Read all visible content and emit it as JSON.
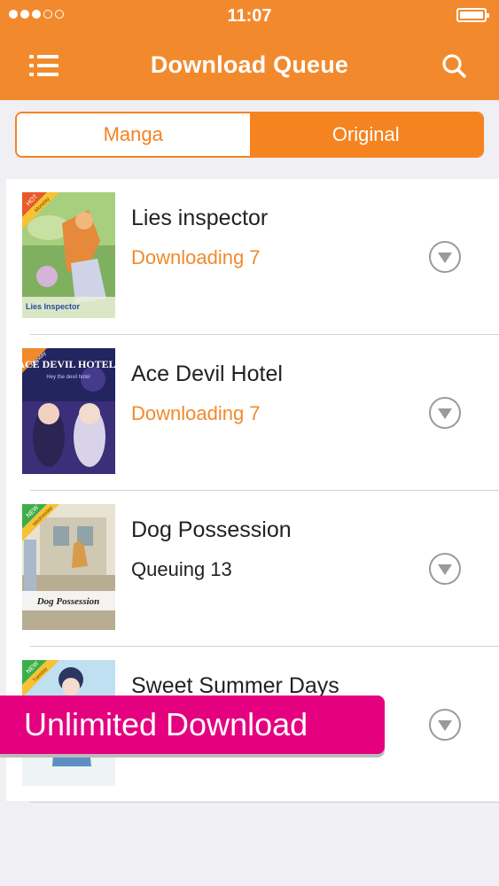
{
  "status_bar": {
    "time": "11:07"
  },
  "header": {
    "title": "Download Queue",
    "menu_icon": "list-icon",
    "search_icon": "search-icon"
  },
  "tabs": [
    {
      "label": "Manga",
      "selected": false
    },
    {
      "label": "Original",
      "selected": true
    }
  ],
  "queue": [
    {
      "title": "Lies inspector",
      "status": "Downloading 7",
      "status_type": "downloading",
      "cover_text": "Lies Inspector",
      "badge": "HOT",
      "badge_sub": "Monday"
    },
    {
      "title": "Ace Devil Hotel",
      "status": "Downloading 7",
      "status_type": "downloading",
      "cover_text": "ACE DEVIL HOTEL",
      "cover_sub": "Hey the devil hotel",
      "badge": "",
      "badge_sub": "Monday"
    },
    {
      "title": "Dog Possession",
      "status": "Queuing 13",
      "status_type": "queuing",
      "cover_text": "Dog Possession",
      "badge": "NEW",
      "badge_sub": "Wednesday"
    },
    {
      "title": "Sweet Summer Days",
      "status": "",
      "status_type": "queuing",
      "badge": "NEW",
      "badge_sub": "Tuesday"
    }
  ],
  "promo_banner": {
    "text": "Unlimited Download"
  },
  "colors": {
    "accent": "#f28a2d",
    "tab_active": "#f5831f",
    "status_downloading": "#f08a2b",
    "promo": "#e5007f"
  }
}
